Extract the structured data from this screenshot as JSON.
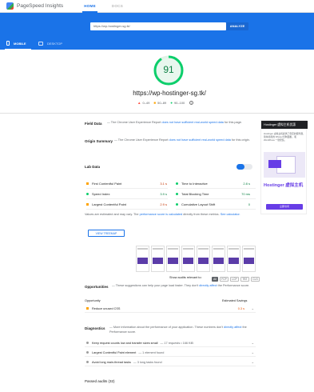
{
  "app": {
    "brand": "PageSpeed Insights",
    "nav": [
      "HOME",
      "DOCS"
    ]
  },
  "search": {
    "url": "https://wp-hostinger-sg.tk/",
    "analyze": "ANALYZE"
  },
  "device_tabs": [
    "MOBILE",
    "DESKTOP"
  ],
  "score": {
    "value": "91",
    "url": "https://wp-hostinger-sg.tk/",
    "legend": [
      {
        "mark": "▲",
        "range": "0–49",
        "color": "#ff4e42"
      },
      {
        "mark": "■",
        "range": "50–89",
        "color": "#ffa400"
      },
      {
        "mark": "●",
        "range": "90–100",
        "color": "#0cce6b"
      }
    ]
  },
  "field": {
    "title": "Field Data",
    "text_pre": "— The Chrome User Experience Report ",
    "link": "does not have sufficient real-world speed data",
    "text_post": " for this page."
  },
  "origin": {
    "title": "Origin Summary",
    "text_pre": "— The Chrome User Experience Report ",
    "link": "does not have sufficient real-world speed data",
    "text_post": " for this origin."
  },
  "lab": {
    "title": "Lab Data",
    "metrics": [
      {
        "label": "First Contentful Paint",
        "value": "3.1 s",
        "color": "#ffa400",
        "shape": "square"
      },
      {
        "label": "Time to Interactive",
        "value": "2.8 s",
        "color": "#0cce6b",
        "shape": "dot"
      },
      {
        "label": "Speed Index",
        "value": "3.9 s",
        "color": "#0cce6b",
        "shape": "dot"
      },
      {
        "label": "Total Blocking Time",
        "value": "70 ms",
        "color": "#0cce6b",
        "shape": "dot"
      },
      {
        "label": "Largest Contentful Paint",
        "value": "2.9 s",
        "color": "#ffa400",
        "shape": "square"
      },
      {
        "label": "Cumulative Layout Shift",
        "value": "0",
        "color": "#0cce6b",
        "shape": "dot"
      }
    ],
    "note_pre": "Values are estimated and may vary. The ",
    "note_link": "performance score is calculated",
    "note_post": " directly from these metrics. ",
    "note_link2": "See calculator.",
    "treemap": "VIEW TREEMAP"
  },
  "filter": {
    "label": "Show audits relevant to:",
    "chips": [
      "All",
      "FCP",
      "LCP",
      "TBT",
      "CLS"
    ]
  },
  "opportunities": {
    "title": "Opportunities",
    "desc": "— These suggestions can help your page load faster. They don't ",
    "desc_link": "directly affect",
    "desc_post": " the Performance score.",
    "col1": "Opportunity",
    "col2": "Estimated Savings",
    "rows": [
      {
        "label": "Reduce unused CSS",
        "value": "0.3 s"
      }
    ]
  },
  "diagnostics": {
    "title": "Diagnostics",
    "desc": "— More information about the performance of your application. These numbers don't ",
    "desc_link": "directly affect",
    "desc_post": " the Performance score.",
    "rows": [
      {
        "label": "Keep request counts low and transfer sizes small",
        "extra": "— 17 requests • 166 KiB"
      },
      {
        "label": "Largest Contentful Paint element",
        "extra": "— 1 element found"
      },
      {
        "label": "Avoid long main-thread tasks",
        "extra": "— 3 long tasks found"
      }
    ]
  },
  "passed": {
    "label": "Passed audits (32)"
  },
  "ad": {
    "header": "Hostinger 虚拟主机优惠",
    "body": "Hostinger 虚拟主机提供了稳定的服务器，简单易用的 hPanel 控制面板，和 WordPress 一键安装。",
    "brand": "Hostinger 虚拟主机",
    "cta": "立即访问"
  }
}
